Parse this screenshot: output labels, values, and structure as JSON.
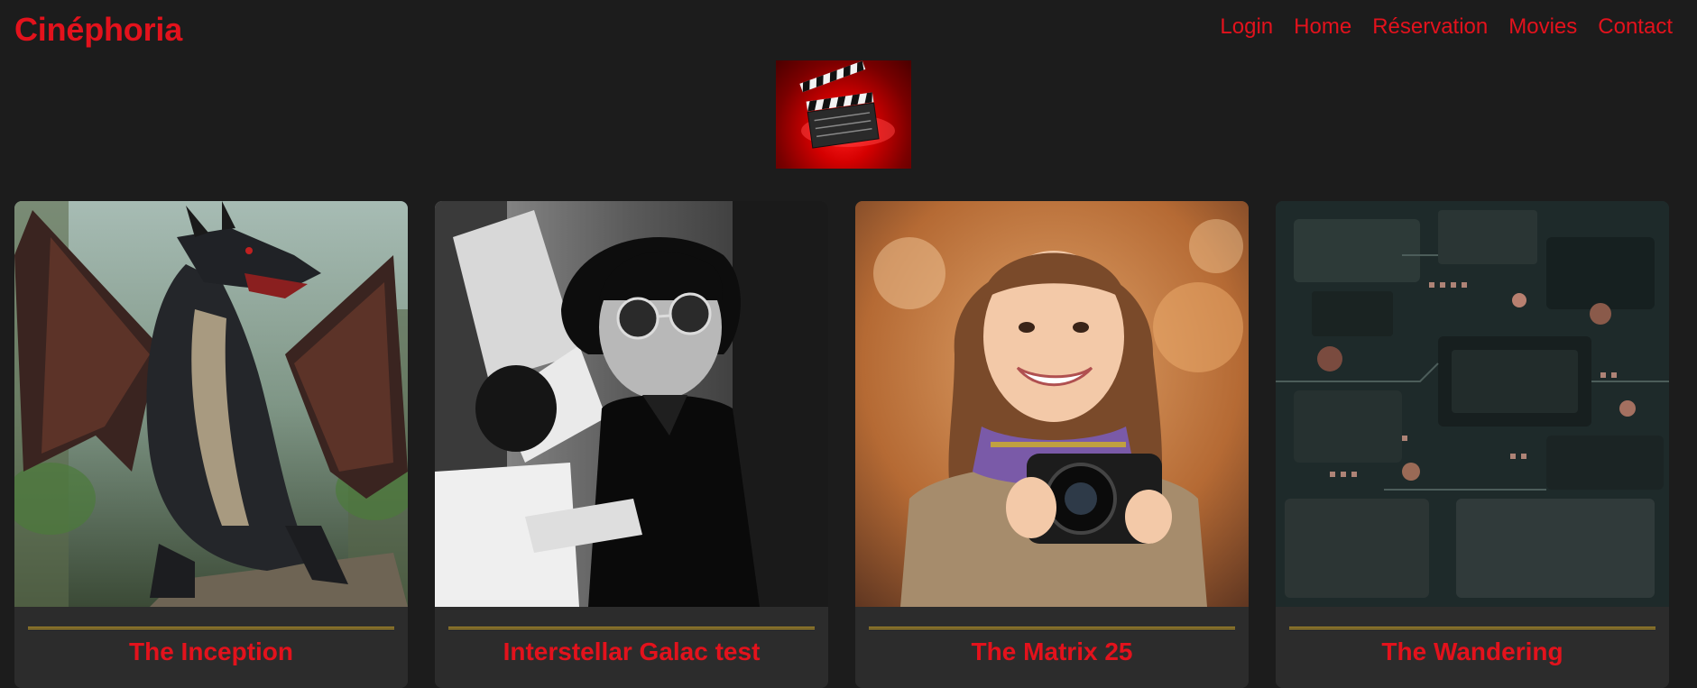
{
  "header": {
    "brand": "Cinéphoria",
    "nav": [
      {
        "label": "Login"
      },
      {
        "label": "Home"
      },
      {
        "label": "Réservation"
      },
      {
        "label": "Movies"
      },
      {
        "label": "Contact"
      }
    ]
  },
  "colors": {
    "background": "#1c1c1c",
    "accent": "#e3121c",
    "card": "#2c2c2c",
    "divider": "#c9a227"
  },
  "logo": {
    "icon": "clapperboard-icon"
  },
  "movies": [
    {
      "title": "The Inception",
      "poster": "dragon-poster"
    },
    {
      "title": "Interstellar Galac test",
      "poster": "black-white-portrait-poster"
    },
    {
      "title": "The Matrix 25",
      "poster": "girl-with-camera-poster"
    },
    {
      "title": "The Wandering",
      "poster": "circuit-board-poster"
    }
  ]
}
